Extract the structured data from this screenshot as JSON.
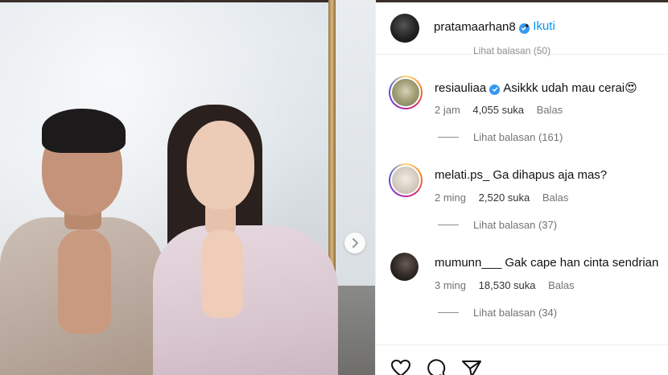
{
  "post": {
    "header": {
      "username": "pratamaarhan8",
      "dot": "•",
      "follow_label": "Ikuti"
    },
    "partial_reply_label": "Lihat balasan (50)",
    "comments": [
      {
        "username": "resiauliaa",
        "verified": true,
        "text": "Asikkk udah mau cerai😍",
        "time": "2 jam",
        "likes": "4,055 suka",
        "reply_label": "Balas",
        "view_replies": "Lihat balasan (161)"
      },
      {
        "username": "melati.ps_",
        "verified": false,
        "text": "Ga dihapus aja mas?",
        "time": "2 ming",
        "likes": "2,520 suka",
        "reply_label": "Balas",
        "view_replies": "Lihat balasan (37)"
      },
      {
        "username": "mumunn___",
        "verified": false,
        "text": "Gak cape han cinta sendrian",
        "time": "3 ming",
        "likes": "18,530 suka",
        "reply_label": "Balas",
        "view_replies": "Lihat balasan (34)"
      }
    ],
    "actions": [
      "heart-icon",
      "comment-icon",
      "share-icon"
    ]
  },
  "colors": {
    "accent": "#0095f6",
    "verified": "#3897f0",
    "muted": "#737373"
  }
}
